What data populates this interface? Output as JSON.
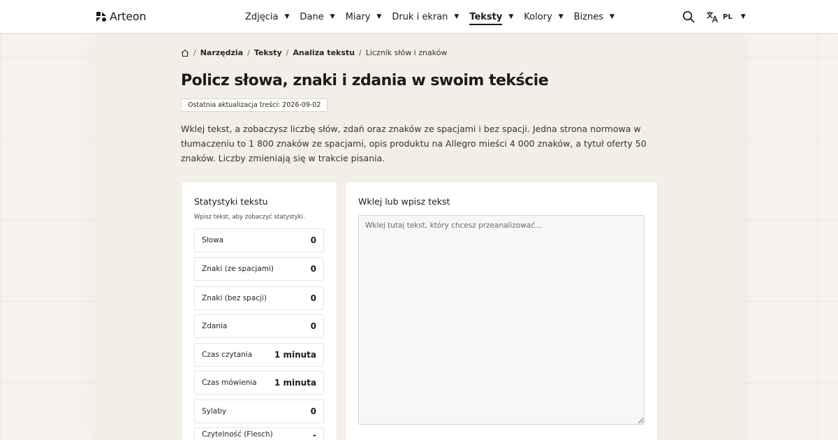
{
  "brand": {
    "name": "Arteon"
  },
  "nav": [
    {
      "label": "Zdjęcia",
      "active": false
    },
    {
      "label": "Dane",
      "active": false
    },
    {
      "label": "Miary",
      "active": false
    },
    {
      "label": "Druk i ekran",
      "active": false
    },
    {
      "label": "Teksty",
      "active": true
    },
    {
      "label": "Kolory",
      "active": false
    },
    {
      "label": "Biznes",
      "active": false
    }
  ],
  "nav_caret": "▼",
  "language": {
    "code": "PL"
  },
  "breadcrumb": {
    "items": [
      "Narzędzia",
      "Teksty",
      "Analiza tekstu"
    ],
    "current": "Licznik słów i znaków",
    "separator": "/"
  },
  "page": {
    "title": "Policz słowa, znaki i zdania w swoim tekście",
    "updated": "Ostatnia aktualizacja treści: 2026-09-02",
    "intro": "Wklej tekst, a zobaczysz liczbę słów, zdań oraz znaków ze spacjami i bez spacji. Jedna strona normowa w tłumaczeniu to 1 800 znaków ze spacjami, opis produktu na Allegro mieści 4 000 znaków, a tytuł oferty 50 znaków. Liczby zmieniają się w trakcie pisania."
  },
  "stats": {
    "title": "Statystyki tekstu",
    "hint": "Wpisz tekst, aby zobaczyć statystyki.",
    "rows": [
      {
        "label": "Słowa",
        "value": "0"
      },
      {
        "label": "Znaki (ze spacjami)",
        "value": "0"
      },
      {
        "label": "Znaki (bez spacji)",
        "value": "0"
      },
      {
        "label": "Zdania",
        "value": "0"
      },
      {
        "label": "Czas czytania",
        "value": "1 minuta"
      },
      {
        "label": "Czas mówienia",
        "value": "1 minuta"
      },
      {
        "label": "Sylaby",
        "value": "0"
      },
      {
        "label": "Czytelność (Flesch)",
        "value": "-"
      }
    ]
  },
  "input": {
    "title": "Wklej lub wpisz tekst",
    "placeholder": "Wklej tutaj tekst, który chcesz przeanalizować...",
    "value": ""
  },
  "colors": {
    "background": "#f6f3ef",
    "panel": "#f3eee8",
    "text": "#1f1a17",
    "card": "#ffffff"
  }
}
